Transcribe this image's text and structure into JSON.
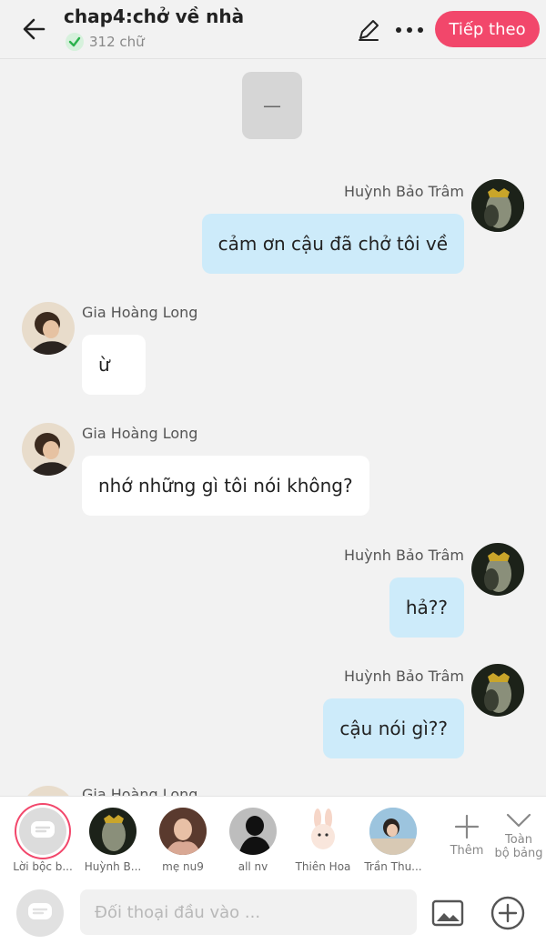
{
  "header": {
    "title": "chap4:chở về nhà",
    "word_count": "312 chữ",
    "next_label": "Tiếp theo"
  },
  "narration": {
    "text": "—"
  },
  "messages": [
    {
      "side": "right",
      "name": "Huỳnh Bảo Trâm",
      "text": "cảm ơn cậu đã chở tôi về"
    },
    {
      "side": "left",
      "name": "Gia Hoàng Long",
      "text": "ừ"
    },
    {
      "side": "left",
      "name": "Gia Hoàng Long",
      "text": "nhớ những gì tôi nói không?"
    },
    {
      "side": "right",
      "name": "Huỳnh Bảo Trâm",
      "text": "hả??"
    },
    {
      "side": "right",
      "name": "Huỳnh Bảo Trâm",
      "text": "cậu nói gì??"
    },
    {
      "side": "left",
      "name": "Gia Hoàng Long",
      "text": ""
    }
  ],
  "characters": [
    {
      "label": "Lời bộc b...",
      "kind": "narrator"
    },
    {
      "label": "Huỳnh B...",
      "kind": "photo-dark"
    },
    {
      "label": "mẹ nu9",
      "kind": "photo-warm"
    },
    {
      "label": "all nv",
      "kind": "silhouette"
    },
    {
      "label": "Thiên Hoa",
      "kind": "bunny"
    },
    {
      "label": "Trần Thu...",
      "kind": "photo-light"
    }
  ],
  "tools": {
    "more_label": "Thêm",
    "all_label_1": "Toàn",
    "all_label_2": "bộ bảng"
  },
  "input": {
    "placeholder": "Đối thoại đầu vào ..."
  },
  "colors": {
    "accent": "#f2476b",
    "right_bubble": "#cdebfa",
    "left_bubble": "#ffffff"
  }
}
